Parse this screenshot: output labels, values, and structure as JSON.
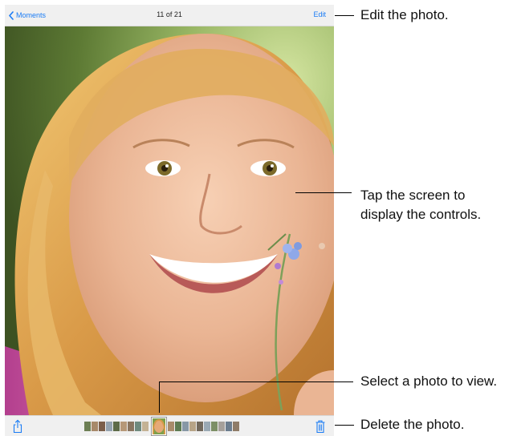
{
  "navbar": {
    "back_label": "Moments",
    "title": "11 of 21",
    "edit_label": "Edit"
  },
  "callouts": {
    "edit": "Edit the photo.",
    "tap_line1": "Tap the screen to",
    "tap_line2": "display the controls.",
    "select": "Select a photo to view.",
    "delete": "Delete the photo."
  },
  "colors": {
    "accent": "#1a7cf5",
    "bar_background": "#f8f8f8"
  },
  "icons": {
    "back": "chevron-left-icon",
    "share": "share-icon",
    "delete": "trash-icon"
  }
}
